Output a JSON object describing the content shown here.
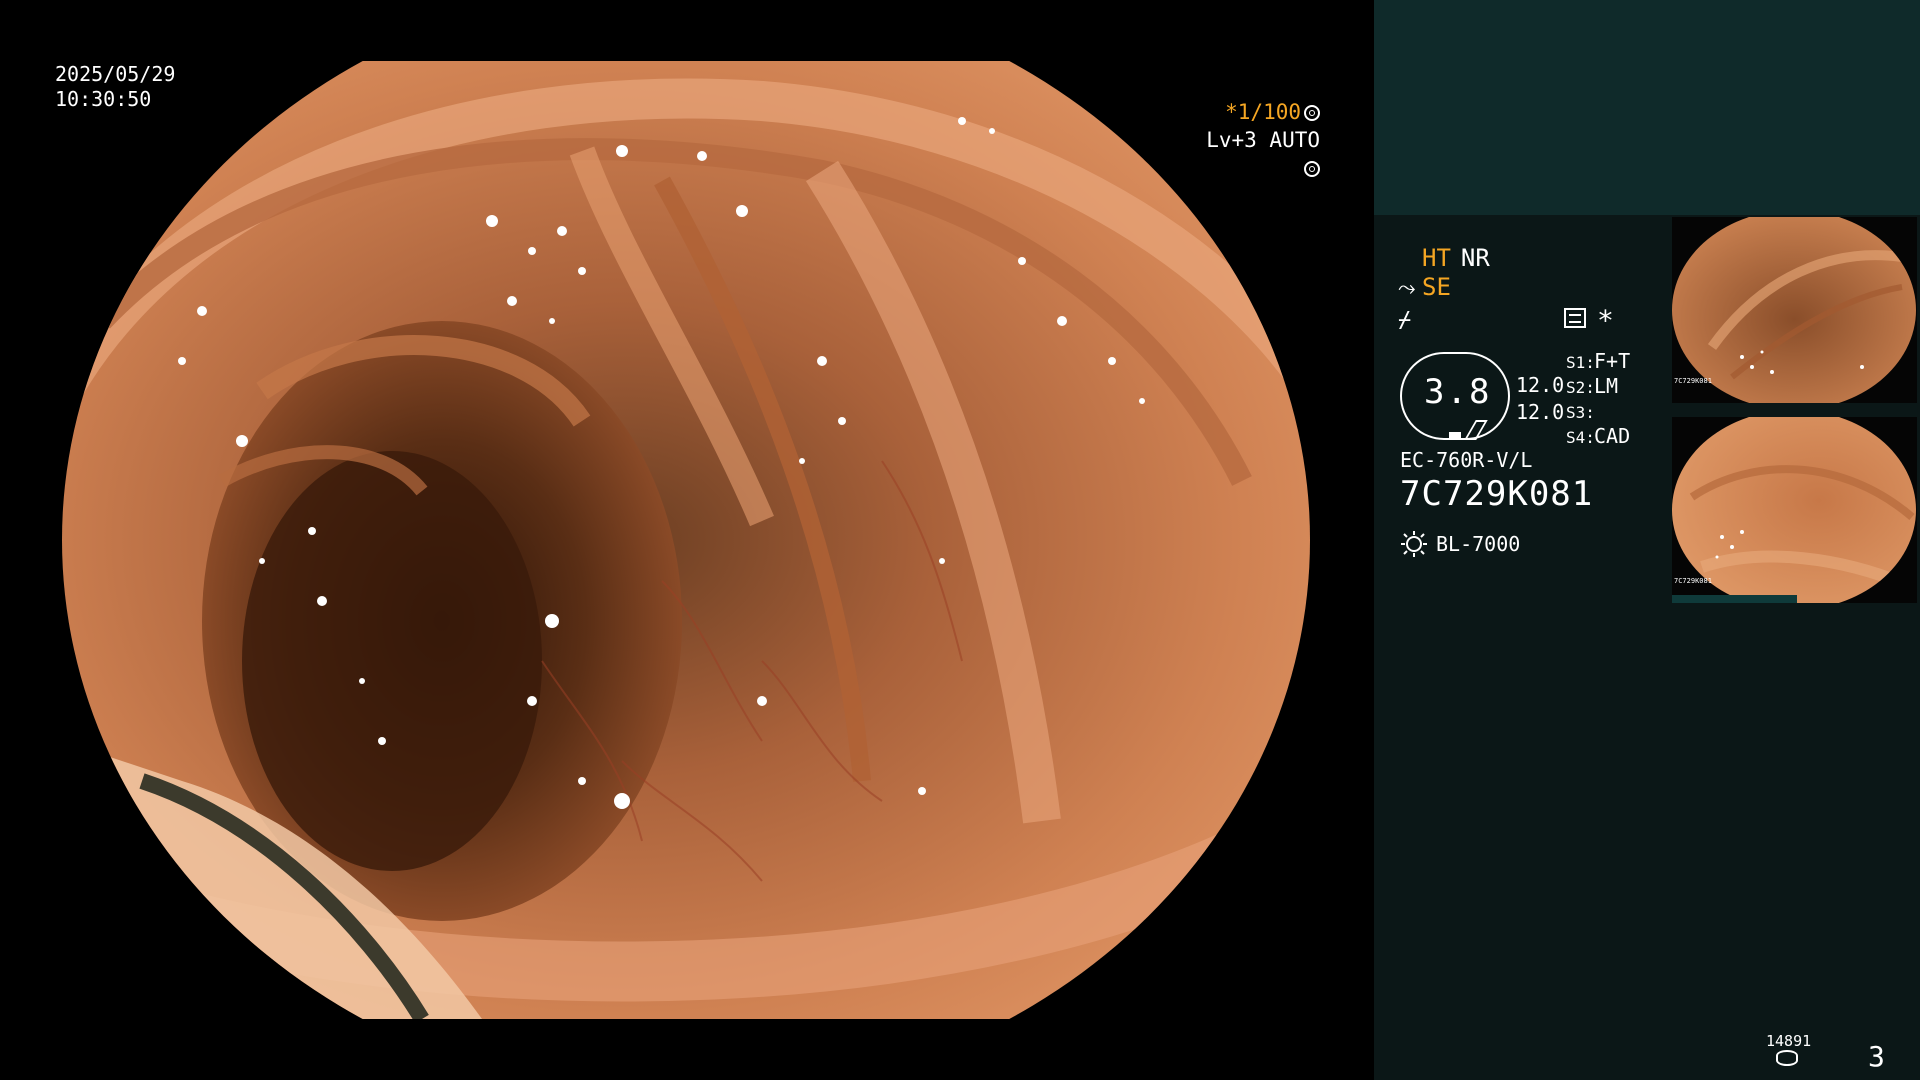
{
  "overlay": {
    "date": "2025/05/29",
    "time": "10:30:50",
    "shutter_prefix": "*",
    "shutter_speed": "1/100",
    "brightness": "Lv+3",
    "exposure_mode": "AUTO"
  },
  "panel": {
    "mode_ht": "HT",
    "mode_nr": "NR",
    "mode_se": "SE",
    "asterisk": "*",
    "zoom_value": "3.8",
    "level_a": "12.0",
    "level_b": "12.0",
    "slots": [
      {
        "label": "S1:",
        "value": "F+T"
      },
      {
        "label": "S2:",
        "value": "LM"
      },
      {
        "label": "S3:",
        "value": ""
      },
      {
        "label": "S4:",
        "value": "CAD"
      }
    ],
    "scope_model": "EC-760R-V/L",
    "serial": "7C729K081",
    "light_source": "BL-7000",
    "disk_count": "14891",
    "page_number": "3"
  },
  "thumbnails": [
    {
      "id": "7C729K081"
    },
    {
      "id": "7C729K081"
    }
  ],
  "colors": {
    "accent": "#f5a623",
    "panel_bg": "#0b1717",
    "panel_top": "#0f2a2a",
    "tissue": "#c8774a"
  },
  "icons": [
    "shutter-icon",
    "auto-exposure-icon",
    "wave-icon",
    "structure-icon",
    "menu-icon",
    "light-icon",
    "disk-icon"
  ]
}
